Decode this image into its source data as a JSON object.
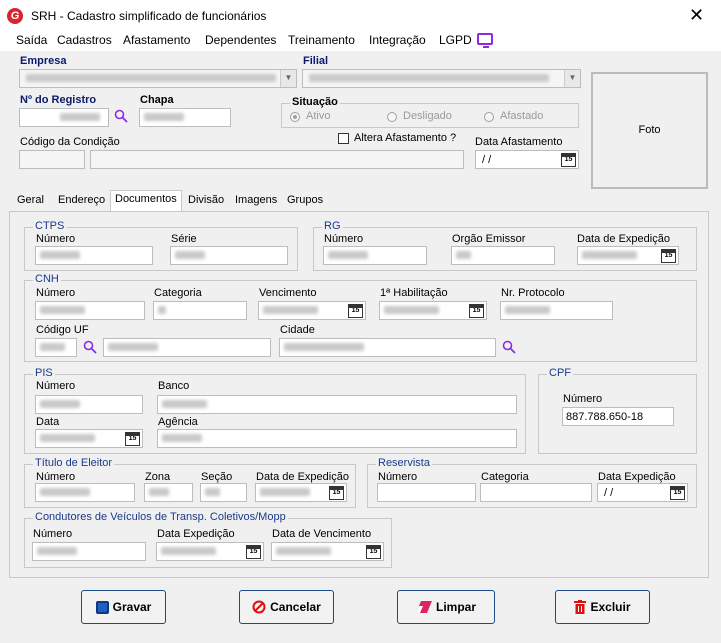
{
  "window": {
    "title": "SRH - Cadastro simplificado de funcionários",
    "close_glyph": "✕",
    "app_icon_letter": "G"
  },
  "menu": [
    "Saída",
    "Cadastros",
    "Afastamento",
    "Dependentes",
    "Treinamento",
    "Integração",
    "LGPD"
  ],
  "header": {
    "empresa_label": "Empresa",
    "filial_label": "Filial",
    "registro_label": "Nº do Registro",
    "chapa_label": "Chapa",
    "situacao_label": "Situação",
    "situacao_options": [
      "Ativo",
      "Desligado",
      "Afastado"
    ],
    "situacao_selected": "Ativo",
    "codigo_condicao_label": "Código da Condição",
    "altera_afastamento_label": "Altera Afastamento ?",
    "data_afastamento_label": "Data Afastamento",
    "data_afastamento_value": " /  /",
    "foto_label": "Foto"
  },
  "tabs": [
    "Geral",
    "Endereço",
    "Documentos",
    "Divisão",
    "Imagens",
    "Grupos"
  ],
  "active_tab": "Documentos",
  "ctps": {
    "title": "CTPS",
    "numero_label": "Número",
    "serie_label": "Série"
  },
  "rg": {
    "title": "RG",
    "numero_label": "Número",
    "orgao_label": "Orgão Emissor",
    "data_label": "Data de Expedição"
  },
  "cnh": {
    "title": "CNH",
    "numero_label": "Número",
    "categoria_label": "Categoria",
    "vencimento_label": "Vencimento",
    "habilitacao_label": "1ª Habilitação",
    "protocolo_label": "Nr. Protocolo",
    "codigo_uf_label": "Código UF",
    "cidade_label": "Cidade"
  },
  "pis": {
    "title": "PIS",
    "numero_label": "Número",
    "banco_label": "Banco",
    "data_label": "Data",
    "agencia_label": "Agência"
  },
  "cpf": {
    "title": "CPF",
    "numero_label": "Número",
    "numero_value": "887.788.650-18"
  },
  "titulo": {
    "title": "Título de Eleitor",
    "numero_label": "Número",
    "zona_label": "Zona",
    "secao_label": "Seção",
    "data_label": "Data de Expedição"
  },
  "reservista": {
    "title": "Reservista",
    "numero_label": "Número",
    "categoria_label": "Categoria",
    "data_label": "Data Expedição",
    "data_value": " /  /"
  },
  "condutores": {
    "title": "Condutores de Veículos de Transp. Coletivos/Mopp",
    "numero_label": "Número",
    "data_exp_label": "Data Expedição",
    "data_venc_label": "Data de Vencimento"
  },
  "buttons": {
    "gravar": "Gravar",
    "cancelar": "Cancelar",
    "limpar": "Limpar",
    "excluir": "Excluir"
  },
  "calendar_glyph": "15",
  "colors": {
    "accent_blue": "#0a1a6b",
    "group_title": "#1a3a8a",
    "brand_red": "#d9232d",
    "lgpd_purple": "#8a2be2",
    "search_purple": "#8a2be2"
  }
}
